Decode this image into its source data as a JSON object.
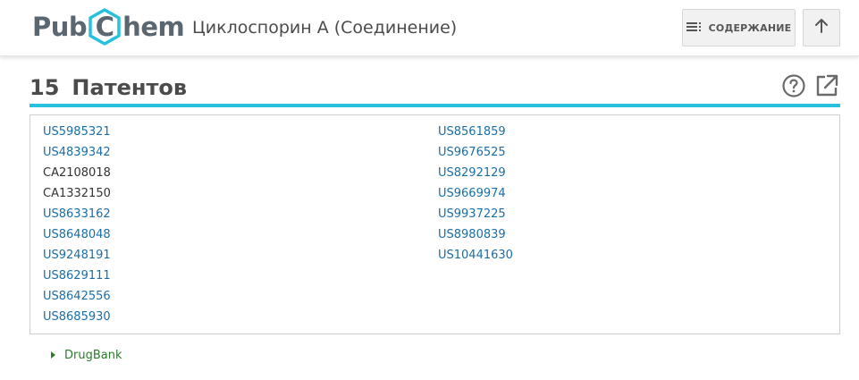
{
  "header": {
    "logo_left": "Pub",
    "logo_mid": "C",
    "logo_right": "hem",
    "page_title": "Циклоспорин А (Соединение)",
    "toc_label": "СОДЕРЖАНИЕ",
    "toc_icon": "list-icon",
    "up_icon": "arrow-up-icon"
  },
  "section": {
    "count": "15",
    "title": "Патентов",
    "accent_color": "#28c1dd"
  },
  "patents": {
    "left": [
      {
        "id": "US5985321",
        "linked": true
      },
      {
        "id": "US4839342",
        "linked": true
      },
      {
        "id": "CA2108018",
        "linked": false
      },
      {
        "id": "CA1332150",
        "linked": false
      },
      {
        "id": "US8633162",
        "linked": true
      },
      {
        "id": "US8648048",
        "linked": true
      },
      {
        "id": "US9248191",
        "linked": true
      },
      {
        "id": "US8629111",
        "linked": true
      },
      {
        "id": "US8642556",
        "linked": true
      },
      {
        "id": "US8685930",
        "linked": true
      }
    ],
    "right": [
      {
        "id": "US8561859",
        "linked": true
      },
      {
        "id": "US9676525",
        "linked": true
      },
      {
        "id": "US8292129",
        "linked": true
      },
      {
        "id": "US9669974",
        "linked": true
      },
      {
        "id": "US9937225",
        "linked": true
      },
      {
        "id": "US8980839",
        "linked": true
      },
      {
        "id": "US10441630",
        "linked": true
      }
    ]
  },
  "source": {
    "label": "DrugBank"
  }
}
